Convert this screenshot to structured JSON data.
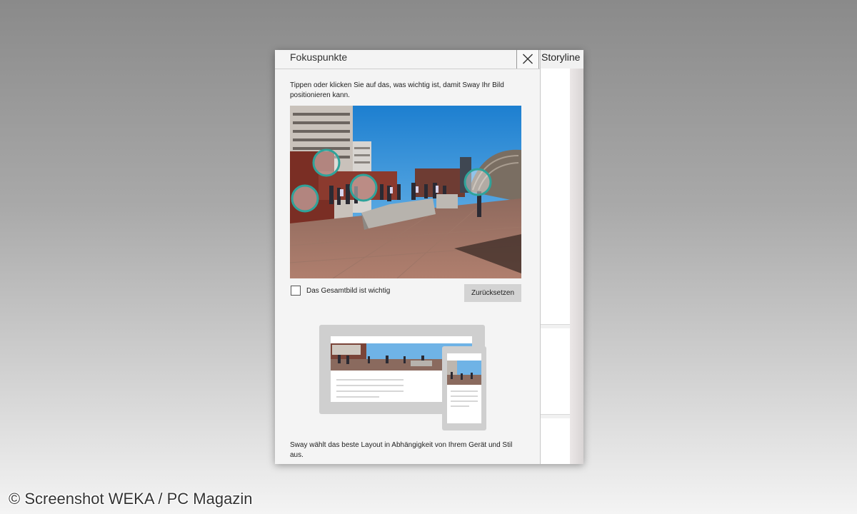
{
  "panel": {
    "title": "Fokuspunkte",
    "close_icon": "close-icon",
    "storyline_label": "Storyline",
    "instructions": "Tippen oder klicken Sie auf das, was wichtig ist, damit Sway Ihr Bild positionieren kann.",
    "checkbox": {
      "label": "Das Gesamtbild ist wichtig",
      "checked": false
    },
    "reset_label": "Zurücksetzen",
    "layout_caption": "Sway wählt das beste Layout in Abhängigkeit von Ihrem Gerät und Stil aus."
  },
  "focus_points_count": 4,
  "colors": {
    "focus_ring": "#2fa39a",
    "panel_bg": "#f4f4f4",
    "button_bg": "#d3d3d3"
  },
  "watermark": "© Screenshot WEKA / PC Magazin"
}
